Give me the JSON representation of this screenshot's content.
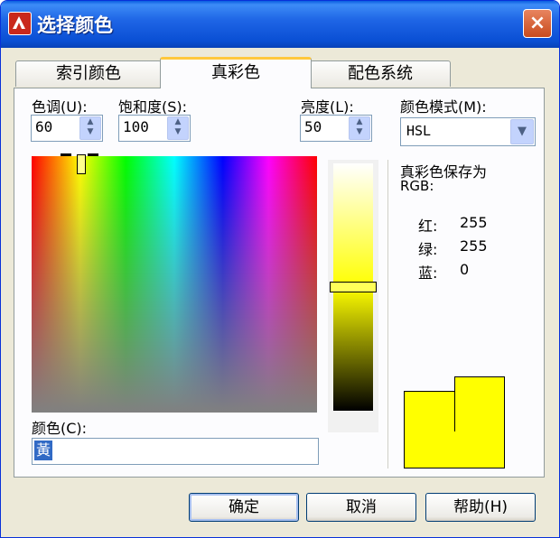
{
  "window": {
    "title": "选择颜色",
    "close_label": "×"
  },
  "tabs": [
    {
      "label": "索引颜色",
      "active": false
    },
    {
      "label": "真彩色",
      "active": true
    },
    {
      "label": "配色系统",
      "active": false
    }
  ],
  "hue": {
    "label": "色调(U):",
    "value": "60"
  },
  "saturation": {
    "label": "饱和度(S):",
    "value": "100"
  },
  "luminance": {
    "label": "亮度(L):",
    "value": "50"
  },
  "color_mode": {
    "label": "颜色模式(M):",
    "value": "HSL",
    "options": [
      "HSL"
    ]
  },
  "info": {
    "saved_as_line1": "真彩色保存为",
    "saved_as_line2": "RGB:",
    "red_label": "红:",
    "red_value": "255",
    "green_label": "绿:",
    "green_value": "255",
    "blue_label": "蓝:",
    "blue_value": "0"
  },
  "color_field": {
    "label": "颜色(C):",
    "value": "黃"
  },
  "swatch": {
    "new_color": "#ffff00",
    "old_color": "#ffff00"
  },
  "buttons": {
    "ok": "确定",
    "cancel": "取消",
    "help": "帮助(H)"
  }
}
